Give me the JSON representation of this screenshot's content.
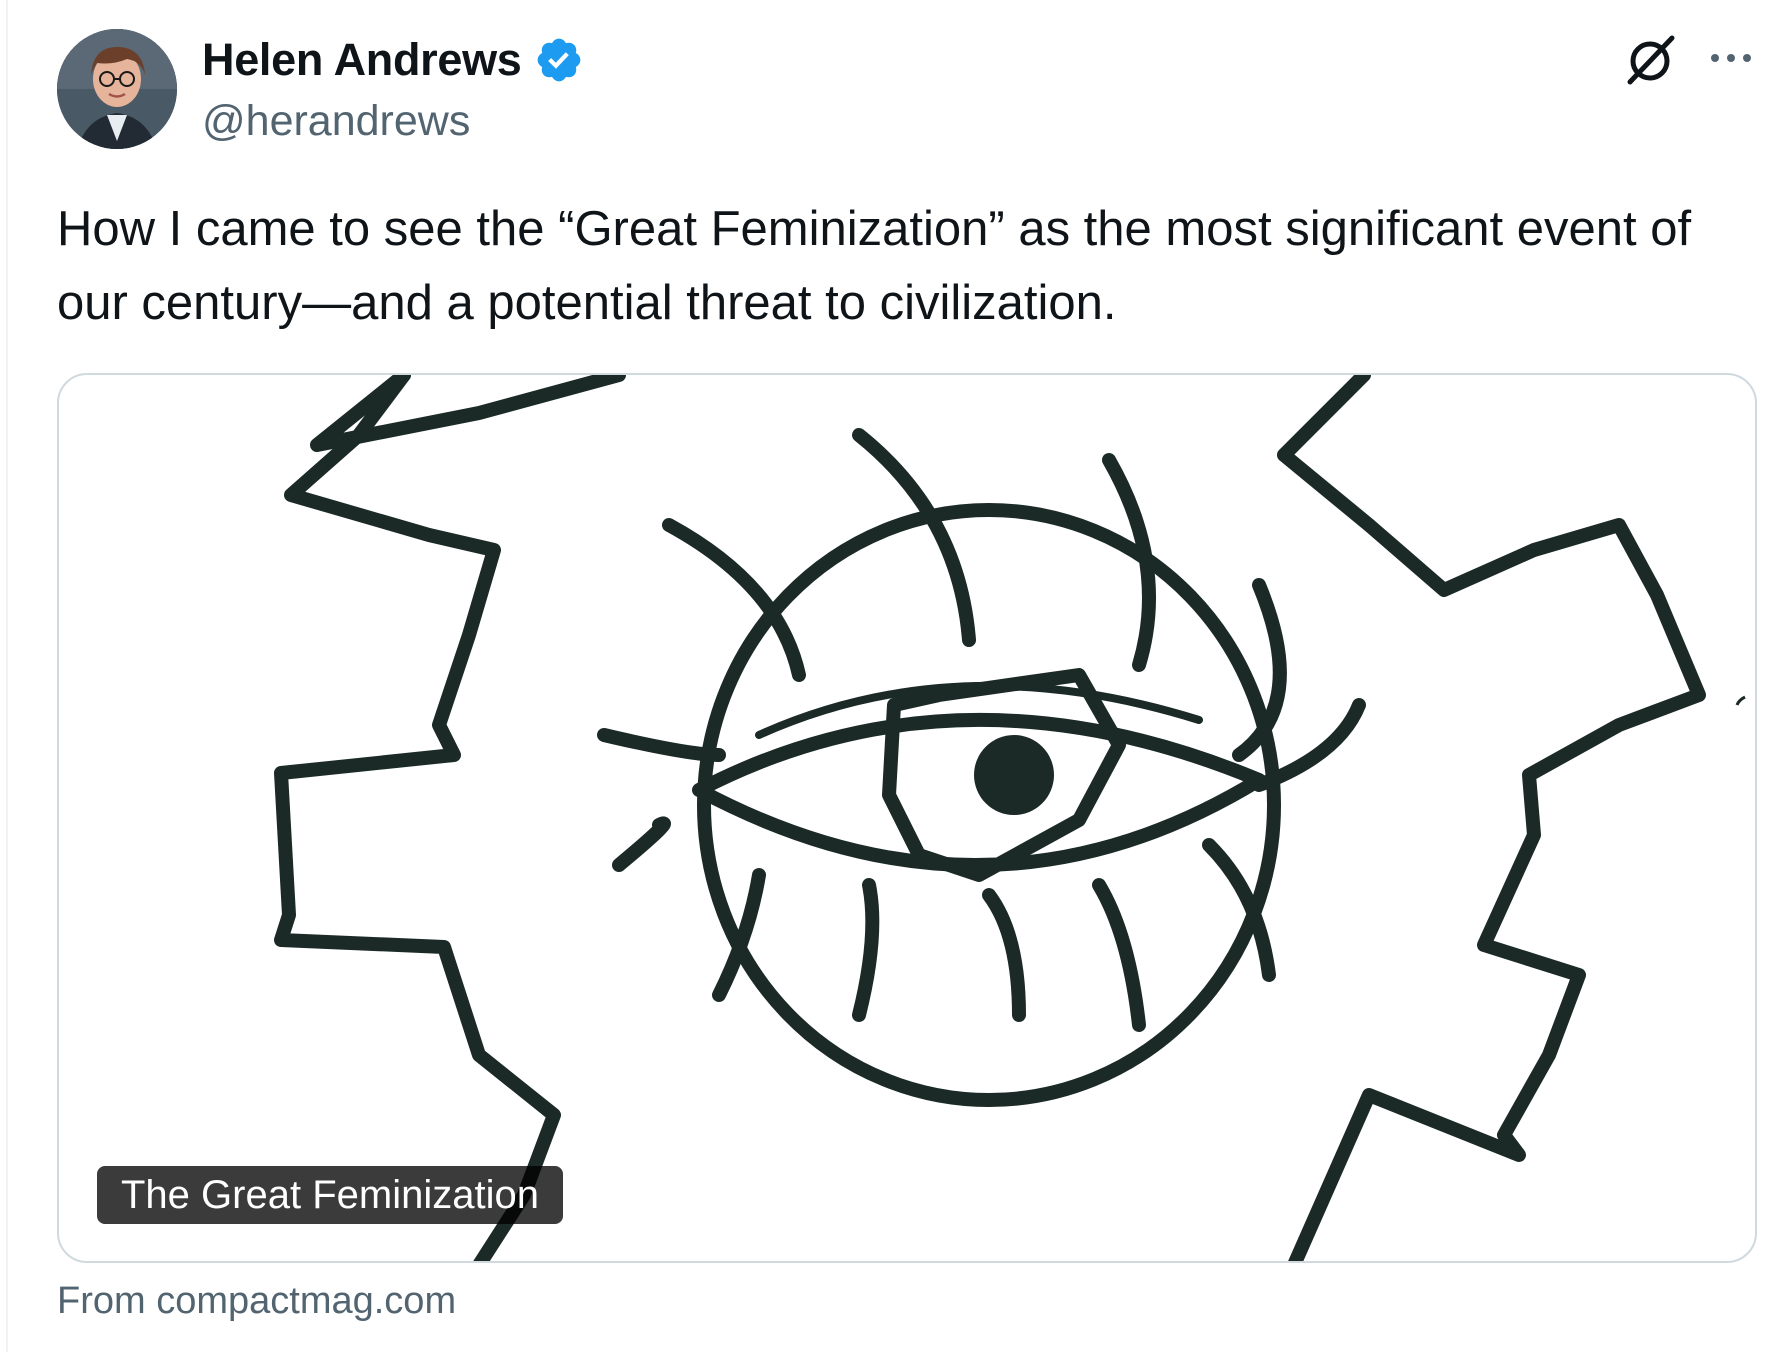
{
  "author": {
    "display_name": "Helen Andrews",
    "handle": "@herandrews",
    "verified_color": "#1d9bf0"
  },
  "icons": {
    "verified": "verified-badge-icon",
    "grok": "grok-icon",
    "more": "more-options-icon"
  },
  "tweet": {
    "text": "How I came to see the “Great Feminization” as the most significant event of our century—and a potential threat to civilization."
  },
  "card": {
    "title": "The Great Feminization",
    "source": "From compactmag.com",
    "ink_color": "#1b2a26"
  }
}
